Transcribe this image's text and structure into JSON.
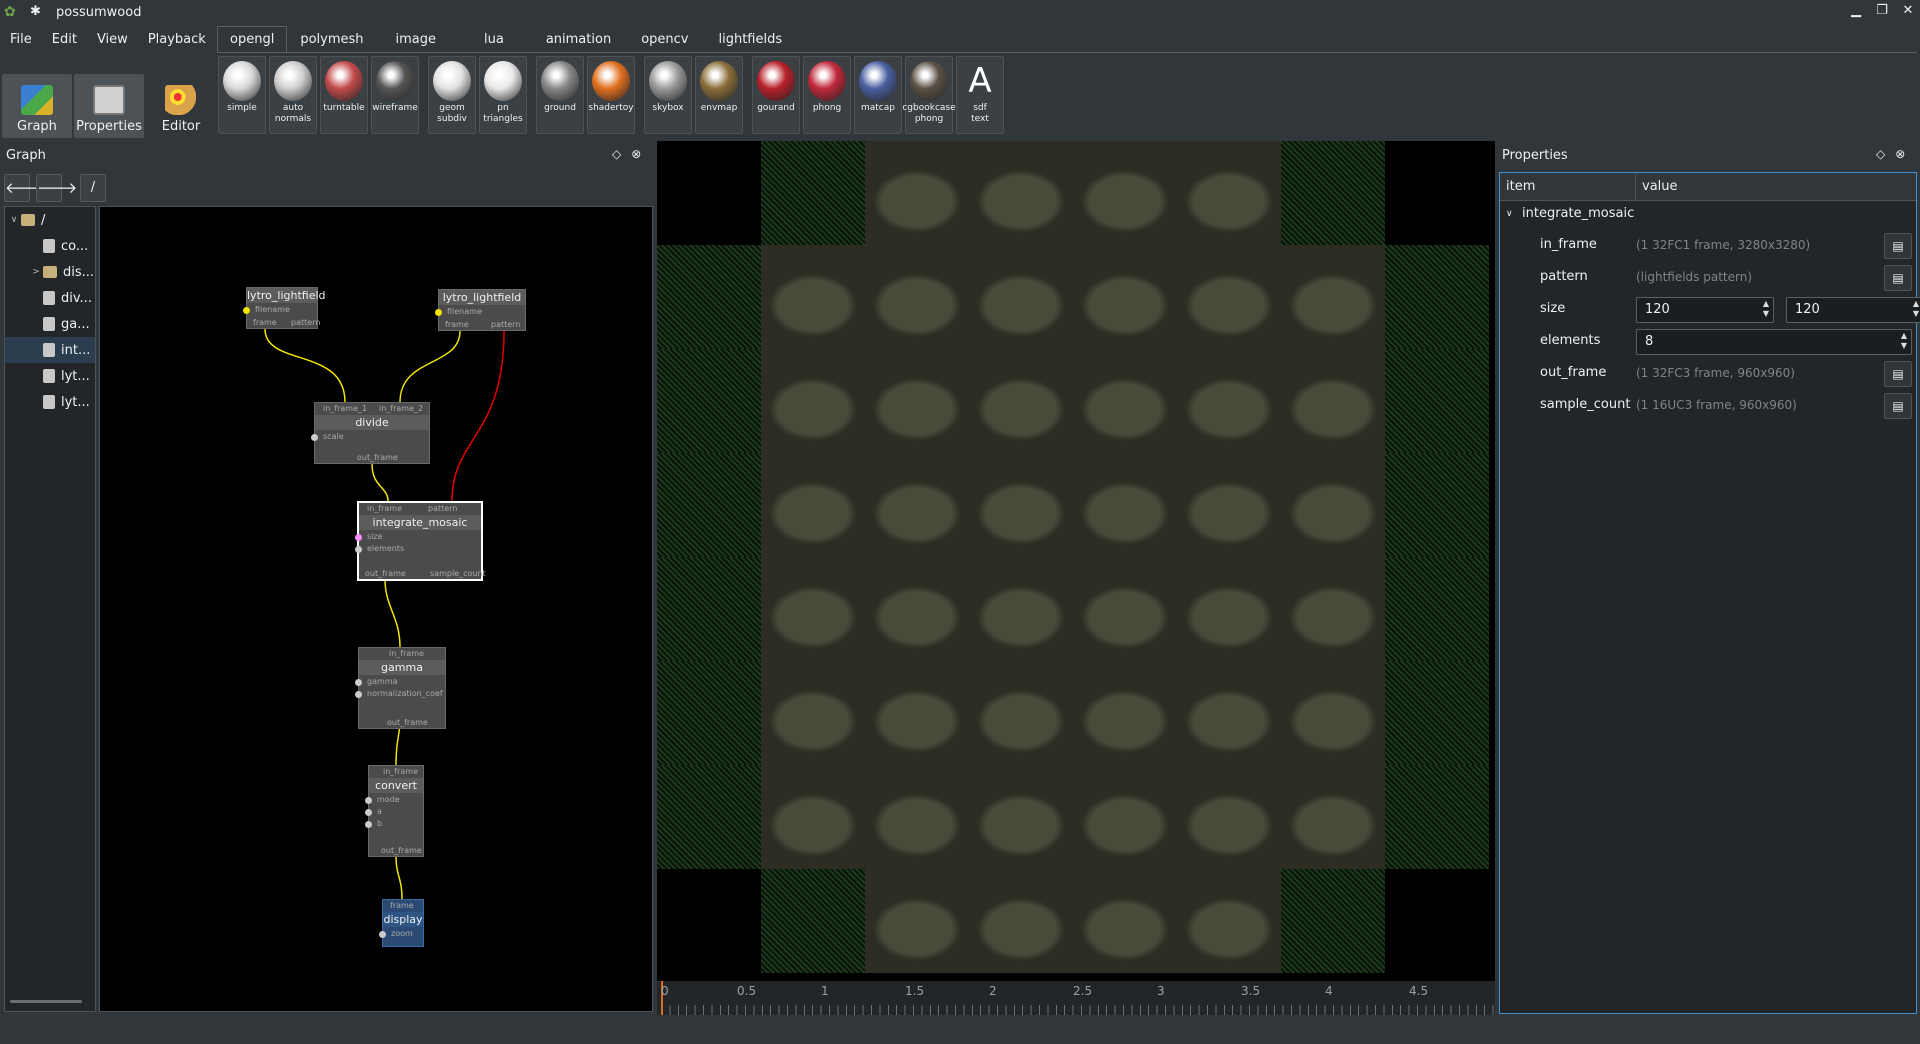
{
  "window": {
    "title": "possumwood",
    "minimize": "▁",
    "restore": "❐",
    "close": "✕"
  },
  "menu": [
    "File",
    "Edit",
    "View",
    "Playback"
  ],
  "modes": [
    {
      "label": "Graph",
      "active": true
    },
    {
      "label": "Properties",
      "active": true
    },
    {
      "label": "Editor",
      "active": false
    }
  ],
  "tabs": [
    "opengl",
    "polymesh",
    "image",
    "lua",
    "animation",
    "opencv",
    "lightfields"
  ],
  "active_tab": "opengl",
  "toolbar": [
    {
      "label": "simple",
      "color": "#d9d9d9"
    },
    {
      "label": "auto\nnormals",
      "color": "#cfcfcf"
    },
    {
      "label": "turntable",
      "color": "#c24a4a"
    },
    {
      "label": "wireframe",
      "color": "#555555"
    },
    {
      "label": "geom\nsubdiv",
      "color": "#e2e2e2"
    },
    {
      "label": "pn\ntriangles",
      "color": "#e8e8e8"
    },
    {
      "label": "ground",
      "color": "#888888"
    },
    {
      "label": "shadertoy",
      "color": "#e0701f"
    },
    {
      "label": "skybox",
      "color": "#9a9a9a"
    },
    {
      "label": "envmap",
      "color": "#8a6e3a"
    },
    {
      "label": "gourand",
      "color": "#b8202a"
    },
    {
      "label": "phong",
      "color": "#c0283a"
    },
    {
      "label": "matcap",
      "color": "#4a5fa0"
    },
    {
      "label": "cgbookcase\nphong",
      "color": "#5a5045"
    },
    {
      "label": "sdf\ntext",
      "color": "#ffffff",
      "glyph": "A"
    }
  ],
  "graph_panel": {
    "title": "Graph",
    "back": "🡐",
    "forward": "🡒",
    "path": "/",
    "tree": [
      {
        "label": "/",
        "type": "folder",
        "expanded": true,
        "indent": 0
      },
      {
        "label": "co...",
        "type": "node",
        "indent": 1
      },
      {
        "label": "dis...",
        "type": "folder",
        "indent": 1,
        "expander": true
      },
      {
        "label": "div...",
        "type": "node",
        "indent": 1
      },
      {
        "label": "ga...",
        "type": "node",
        "indent": 1
      },
      {
        "label": "int...",
        "type": "node",
        "indent": 1,
        "selected": true
      },
      {
        "label": "lyt...",
        "type": "node",
        "indent": 1
      },
      {
        "label": "lyt...",
        "type": "node",
        "indent": 1
      }
    ],
    "nodes": {
      "lytro1": {
        "title": "lytro_lightfield",
        "in": [
          "filename"
        ],
        "out": [
          "frame",
          "pattern"
        ]
      },
      "lytro2": {
        "title": "lytro_lightfield",
        "in": [
          "filename"
        ],
        "out": [
          "frame",
          "pattern"
        ]
      },
      "divide": {
        "title": "divide",
        "top": [
          "in_frame_1",
          "in_frame_2"
        ],
        "in": [
          "scale"
        ],
        "out": [
          "out_frame"
        ]
      },
      "integrate": {
        "title": "integrate_mosaic",
        "top": [
          "in_frame",
          "pattern"
        ],
        "in": [
          "size",
          "elements"
        ],
        "out": [
          "out_frame",
          "sample_count"
        ]
      },
      "gamma": {
        "title": "gamma",
        "top": [
          "in_frame"
        ],
        "in": [
          "gamma",
          "normalization_coef"
        ],
        "out": [
          "out_frame"
        ]
      },
      "convert": {
        "title": "convert",
        "top": [
          "in_frame"
        ],
        "in": [
          "mode",
          "a",
          "b"
        ],
        "out": [
          "out_frame"
        ]
      },
      "display": {
        "title": "display",
        "top": [
          "frame"
        ],
        "in": [
          "zoom"
        ]
      }
    }
  },
  "timeline": {
    "labels": [
      "0",
      "0.5",
      "1",
      "1.5",
      "2",
      "2.5",
      "3",
      "3.5",
      "4",
      "4.5"
    ],
    "range": [
      0,
      5
    ]
  },
  "properties_panel": {
    "title": "Properties",
    "col_item": "item",
    "col_value": "value",
    "group": "integrate_mosaic",
    "rows": [
      {
        "name": "in_frame",
        "value": "(1 32FC1 frame, 3280x3280)",
        "kind": "readonly"
      },
      {
        "name": "pattern",
        "value": "(lightfields pattern)",
        "kind": "readonly"
      },
      {
        "name": "size",
        "value": [
          "120",
          "120"
        ],
        "kind": "spin2"
      },
      {
        "name": "elements",
        "value": "8",
        "kind": "spin1"
      },
      {
        "name": "out_frame",
        "value": "(1 32FC3 frame, 960x960)",
        "kind": "readonly"
      },
      {
        "name": "sample_count",
        "value": "(1 16UC3 frame, 960x960)",
        "kind": "readonly"
      }
    ]
  },
  "colors": {
    "accent": "#3f8fc9",
    "connection_frame": "#f2e500",
    "connection_pattern": "#e00000",
    "background": "#31363b"
  }
}
